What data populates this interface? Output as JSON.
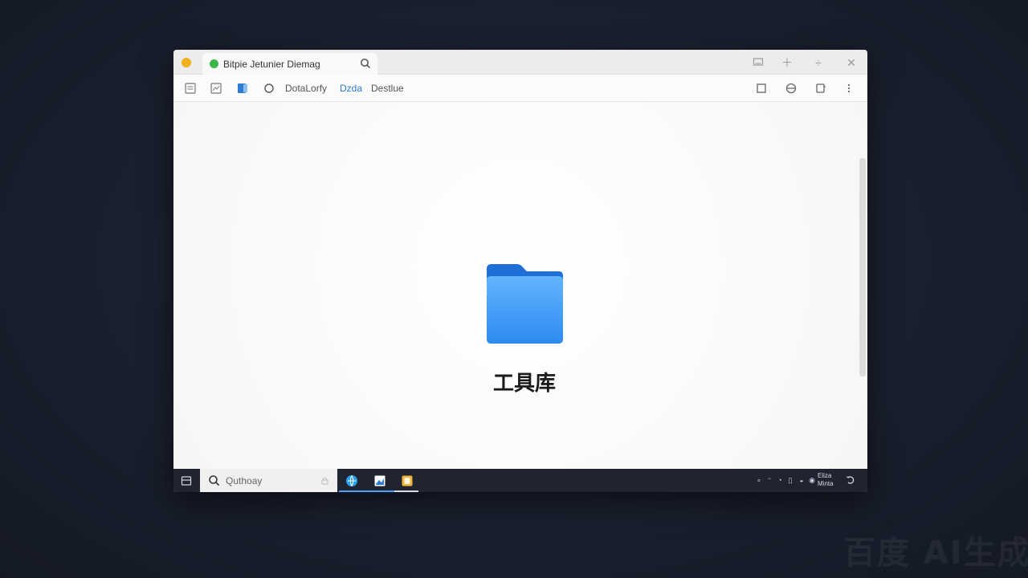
{
  "window": {
    "tab_title": "Bitpie Jetunier Diemag",
    "toolbar_links": [
      "DotaLorfy",
      "Dzda",
      "Destlue"
    ],
    "accent": "#2f7dd1"
  },
  "content": {
    "folder_label": "工具库",
    "folder_icon": "folder-icon",
    "folder_color": "#2d8cf0"
  },
  "taskbar": {
    "search_placeholder": "Quthoay",
    "clock_line1": "Eliza",
    "clock_line2": "Minta"
  },
  "watermark": "百度 AI生成"
}
